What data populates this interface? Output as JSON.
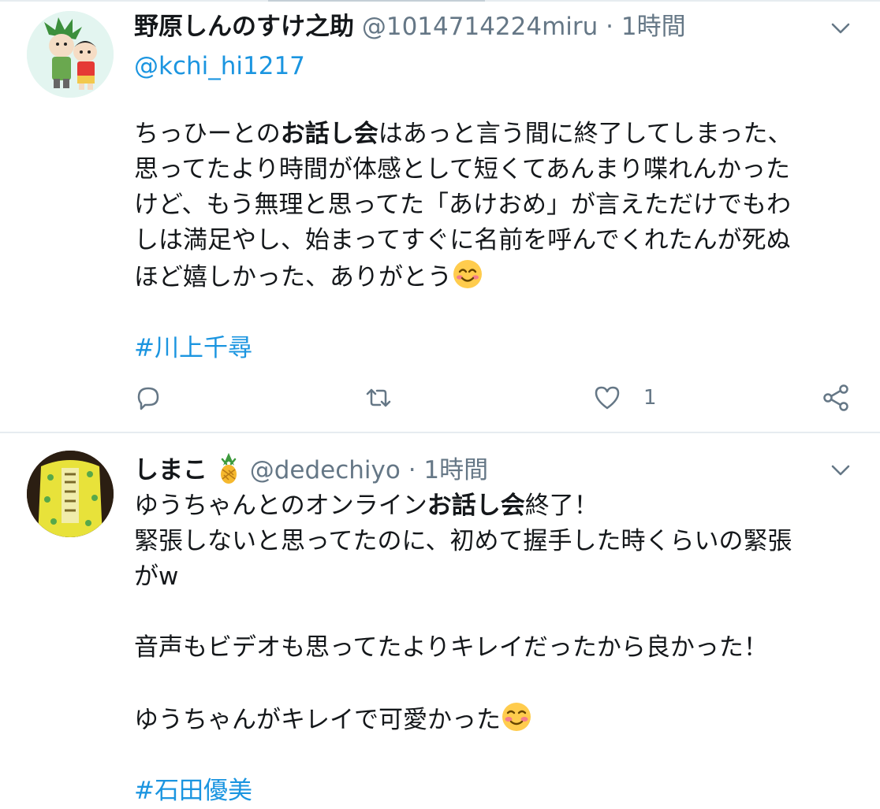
{
  "tweets": [
    {
      "name": "野原しんのすけ之助",
      "handle": "@1014714224miru",
      "dot": "·",
      "time": "1時間",
      "reply_to": "@kchi_hi1217",
      "lines": {
        "l1a": "ちっひーとの",
        "l1b": "お話し会",
        "l1c": "はあっと言う間に終了してしまった、",
        "l2": "思ってたより時間が体感として短くてあんまり喋れんかった",
        "l3": "けど、もう無理と思ってた「あけおめ」が言えただけでもわ",
        "l4": "しは満足やし、始まってすぐに名前を呼んでくれたんが死ぬ",
        "l5": "ほど嬉しかった、ありがとう"
      },
      "emoji": "smiling-face-with-smiling-eyes",
      "hashtag": "#川上千尋",
      "like_count": "1"
    },
    {
      "name": "しまこ",
      "name_emoji": "pineapple",
      "handle": "@dedechiyo",
      "dot": "·",
      "time": "1時間",
      "lines": {
        "l1a": "ゆうちゃんとのオンライン",
        "l1b": "お話し会",
        "l1c": "終了！",
        "l2": "緊張しないと思ってたのに、初めて握手した時くらいの緊張",
        "l3": "がw",
        "l4": "音声もビデオも思ってたよりキレイだったから良かった！",
        "l5": "ゆうちゃんがキレイで可愛かった"
      },
      "emoji": "smiling-face",
      "hashtag": "#石田優美"
    }
  ],
  "colors": {
    "link": "#1b95e0",
    "secondary": "#657786",
    "text": "#14171a",
    "divider": "#e6ecf0"
  }
}
